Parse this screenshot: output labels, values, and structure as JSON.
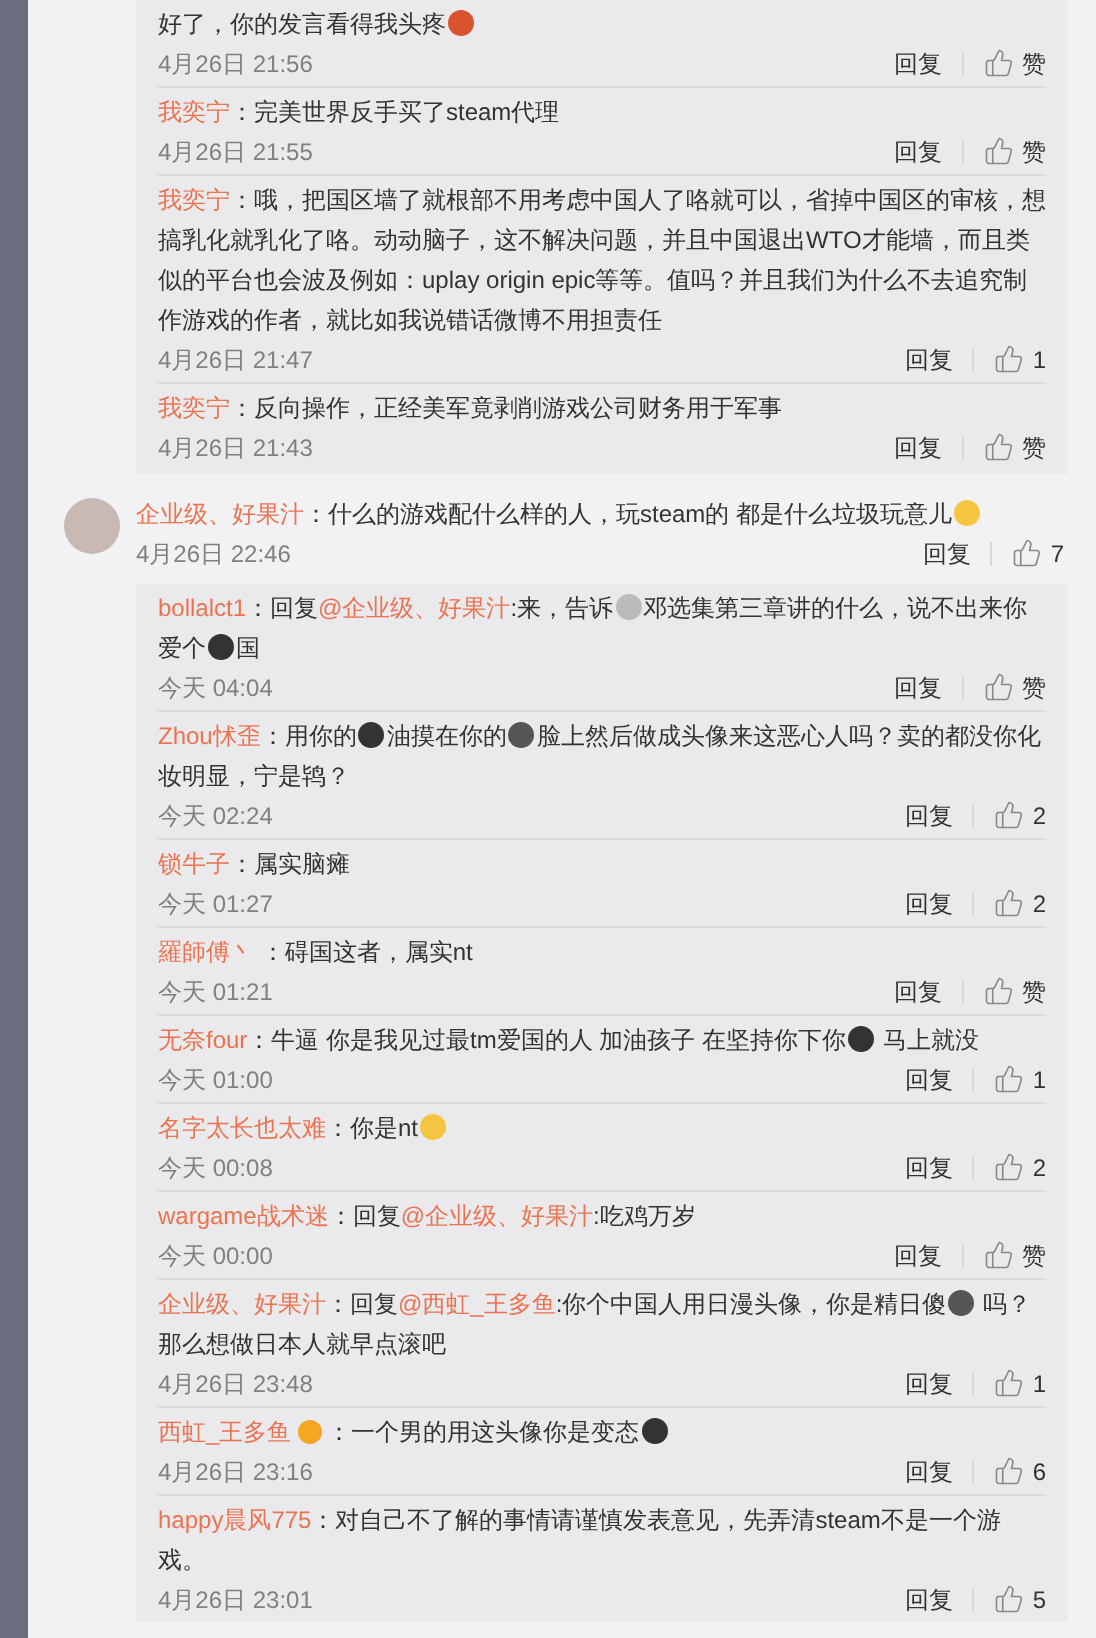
{
  "replies_top": [
    {
      "content": [
        {
          "kind": "text",
          "text": "好了，你的发言看得我头疼"
        },
        {
          "kind": "emoji",
          "color": "#d9542c"
        }
      ],
      "time": "4月26日 21:56",
      "reply": "回复",
      "like": "赞"
    },
    {
      "user": "我奕宁",
      "content": [
        {
          "kind": "text",
          "text": "：完美世界反手买了steam代理"
        }
      ],
      "time": "4月26日 21:55",
      "reply": "回复",
      "like": "赞"
    },
    {
      "user": "我奕宁",
      "content": [
        {
          "kind": "text",
          "text": "：哦，把国区墙了就根部不用考虑中国人了咯就可以，省掉中国区的审核，想搞乳化就乳化了咯。动动脑子，这不解决问题，并且中国退出WTO才能墙，而且类似的平台也会波及例如：uplay origin epic等等。值吗？并且我们为什么不去追究制作游戏的作者，就比如我说错话微博不用担责任"
        }
      ],
      "time": "4月26日 21:47",
      "reply": "回复",
      "like": "1"
    },
    {
      "user": "我奕宁",
      "content": [
        {
          "kind": "text",
          "text": "：反向操作，正经美军竟剥削游戏公司财务用于军事"
        }
      ],
      "time": "4月26日 21:43",
      "reply": "回复",
      "like": "赞"
    }
  ],
  "comment": {
    "user": "企业级、好果汁",
    "content": [
      {
        "kind": "text",
        "text": "：什么的游戏配什么样的人，玩steam的 都是什么垃圾玩意儿"
      },
      {
        "kind": "emoji",
        "color": "#f5c542"
      }
    ],
    "time": "4月26日 22:46",
    "reply": "回复",
    "like": "7"
  },
  "replies": [
    {
      "user": "bollalct1",
      "content": [
        {
          "kind": "text",
          "text": "：回复"
        },
        {
          "kind": "mention",
          "text": "@企业级、好果汁"
        },
        {
          "kind": "text",
          "text": ":来，告诉"
        },
        {
          "kind": "emoji",
          "color": "#bbbbbb"
        },
        {
          "kind": "text",
          "text": "邓选集第三章讲的什么，说不出来你爱个"
        },
        {
          "kind": "emoji",
          "color": "#333333"
        },
        {
          "kind": "text",
          "text": "国"
        }
      ],
      "time": "今天 04:04",
      "reply": "回复",
      "like": "赞"
    },
    {
      "user": "Zhou怵歪",
      "content": [
        {
          "kind": "text",
          "text": "：用你的"
        },
        {
          "kind": "emoji",
          "color": "#333333"
        },
        {
          "kind": "text",
          "text": "油摸在你的"
        },
        {
          "kind": "emoji",
          "color": "#555555"
        },
        {
          "kind": "text",
          "text": "脸上然后做成头像来这恶心人吗？卖的都没你化妆明显，宁是鸨？"
        }
      ],
      "time": "今天 02:24",
      "reply": "回复",
      "like": "2"
    },
    {
      "user": "锁牛子",
      "content": [
        {
          "kind": "text",
          "text": "：属实脑瘫"
        }
      ],
      "time": "今天 01:27",
      "reply": "回复",
      "like": "2"
    },
    {
      "user": "羅師傅丶",
      "content": [
        {
          "kind": "text",
          "text": " ：碍国这者，属实nt"
        }
      ],
      "time": "今天 01:21",
      "reply": "回复",
      "like": "赞"
    },
    {
      "user": "无奈four",
      "content": [
        {
          "kind": "text",
          "text": "：牛逼  你是我见过最tm爱国的人 加油孩子  在坚持你下你"
        },
        {
          "kind": "emoji",
          "color": "#333333"
        },
        {
          "kind": "text",
          "text": " 马上就没"
        }
      ],
      "time": "今天 01:00",
      "reply": "回复",
      "like": "1"
    },
    {
      "user": "名字太长也太难",
      "content": [
        {
          "kind": "text",
          "text": "：你是nt"
        },
        {
          "kind": "emoji",
          "color": "#f5c542"
        }
      ],
      "time": "今天 00:08",
      "reply": "回复",
      "like": "2"
    },
    {
      "user": "wargame战术迷",
      "content": [
        {
          "kind": "text",
          "text": "：回复"
        },
        {
          "kind": "mention",
          "text": "@企业级、好果汁"
        },
        {
          "kind": "text",
          "text": ":吃鸡万岁"
        }
      ],
      "time": "今天 00:00",
      "reply": "回复",
      "like": "赞"
    },
    {
      "user": "企业级、好果汁",
      "content": [
        {
          "kind": "text",
          "text": "：回复"
        },
        {
          "kind": "mention",
          "text": "@西虹_王多鱼"
        },
        {
          "kind": "text",
          "text": ":你个中国人用日漫头像，你是精日傻"
        },
        {
          "kind": "emoji",
          "color": "#555555"
        },
        {
          "kind": "text",
          "text": " 吗？那么想做日本人就早点滚吧"
        }
      ],
      "time": "4月26日 23:48",
      "reply": "回复",
      "like": "1"
    },
    {
      "user": "西虹_王多鱼",
      "badge": true,
      "content": [
        {
          "kind": "text",
          "text": "：一个男的用这头像你是变态"
        },
        {
          "kind": "emoji",
          "color": "#333333"
        }
      ],
      "time": "4月26日 23:16",
      "reply": "回复",
      "like": "6"
    },
    {
      "user": "happy晨风775",
      "content": [
        {
          "kind": "text",
          "text": "：对自己不了解的事情请谨慎发表意见，先弄清steam不是一个游戏。"
        }
      ],
      "time": "4月26日 23:01",
      "reply": "回复",
      "like": "5"
    }
  ]
}
